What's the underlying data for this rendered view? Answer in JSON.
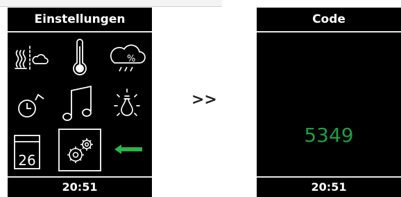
{
  "left_screen": {
    "title": "Einstellungen",
    "time": "20:51",
    "calendar_day": "26",
    "icons": [
      "heating-cloud-icon",
      "thermometer-icon",
      "humidity-cloud-icon",
      "clock-icon",
      "music-note-icon",
      "light-bulb-icon",
      "calendar-icon",
      "gears-icon",
      "back-arrow-icon"
    ],
    "selected_icon": "gears-icon"
  },
  "transition": {
    "label": ">>"
  },
  "right_screen": {
    "title": "Code",
    "code": "5349",
    "time": "20:51"
  },
  "colors": {
    "screen_background": "#000000",
    "icon_color": "#ffffff",
    "accent_green": "#2db34a",
    "code_green": "#1f9d47"
  }
}
